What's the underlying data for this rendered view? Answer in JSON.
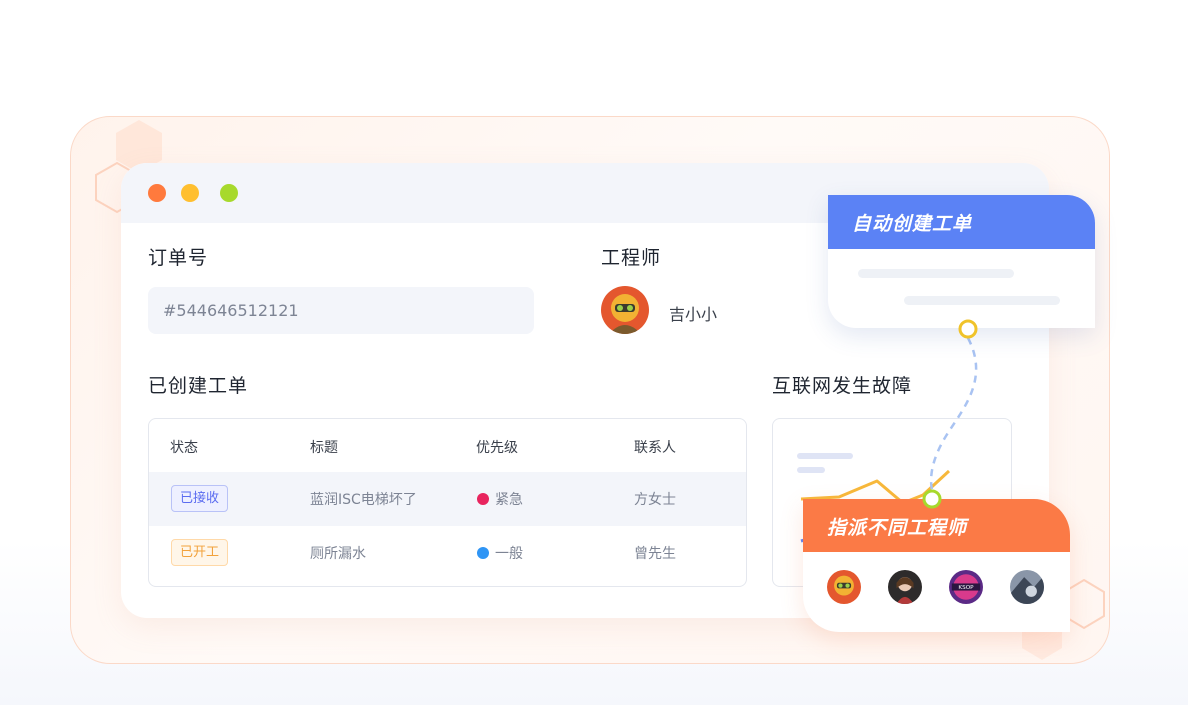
{
  "window": {
    "controls": {
      "close_color": "#ff7a3d",
      "minimize_color": "#ffbf2f",
      "maximize_color": "#a7d92c"
    }
  },
  "order": {
    "label": "订单号",
    "value": "#544646512121"
  },
  "engineer": {
    "label": "工程师",
    "name": "吉小小"
  },
  "tickets": {
    "title": "已创建工单",
    "columns": [
      "状态",
      "标题",
      "优先级",
      "联系人"
    ],
    "rows": [
      {
        "status": "已接收",
        "title": "蓝润ISC电梯坏了",
        "priority": "紧急",
        "priority_color": "#e8245e",
        "contact": "方女士"
      },
      {
        "status": "已开工",
        "title": "厕所漏水",
        "priority": "一般",
        "priority_color": "#2f95f5",
        "contact": "曾先生"
      }
    ]
  },
  "fault": {
    "title": "互联网发生故障"
  },
  "auto_create_card": {
    "title": "自动创建工单",
    "accent": "#5b82f5"
  },
  "dispatch_card": {
    "title": "指派不同工程师",
    "accent": "#fb7a46",
    "engineers": [
      "engineer-avatar-1",
      "engineer-avatar-2",
      "engineer-avatar-3",
      "engineer-avatar-4"
    ]
  }
}
